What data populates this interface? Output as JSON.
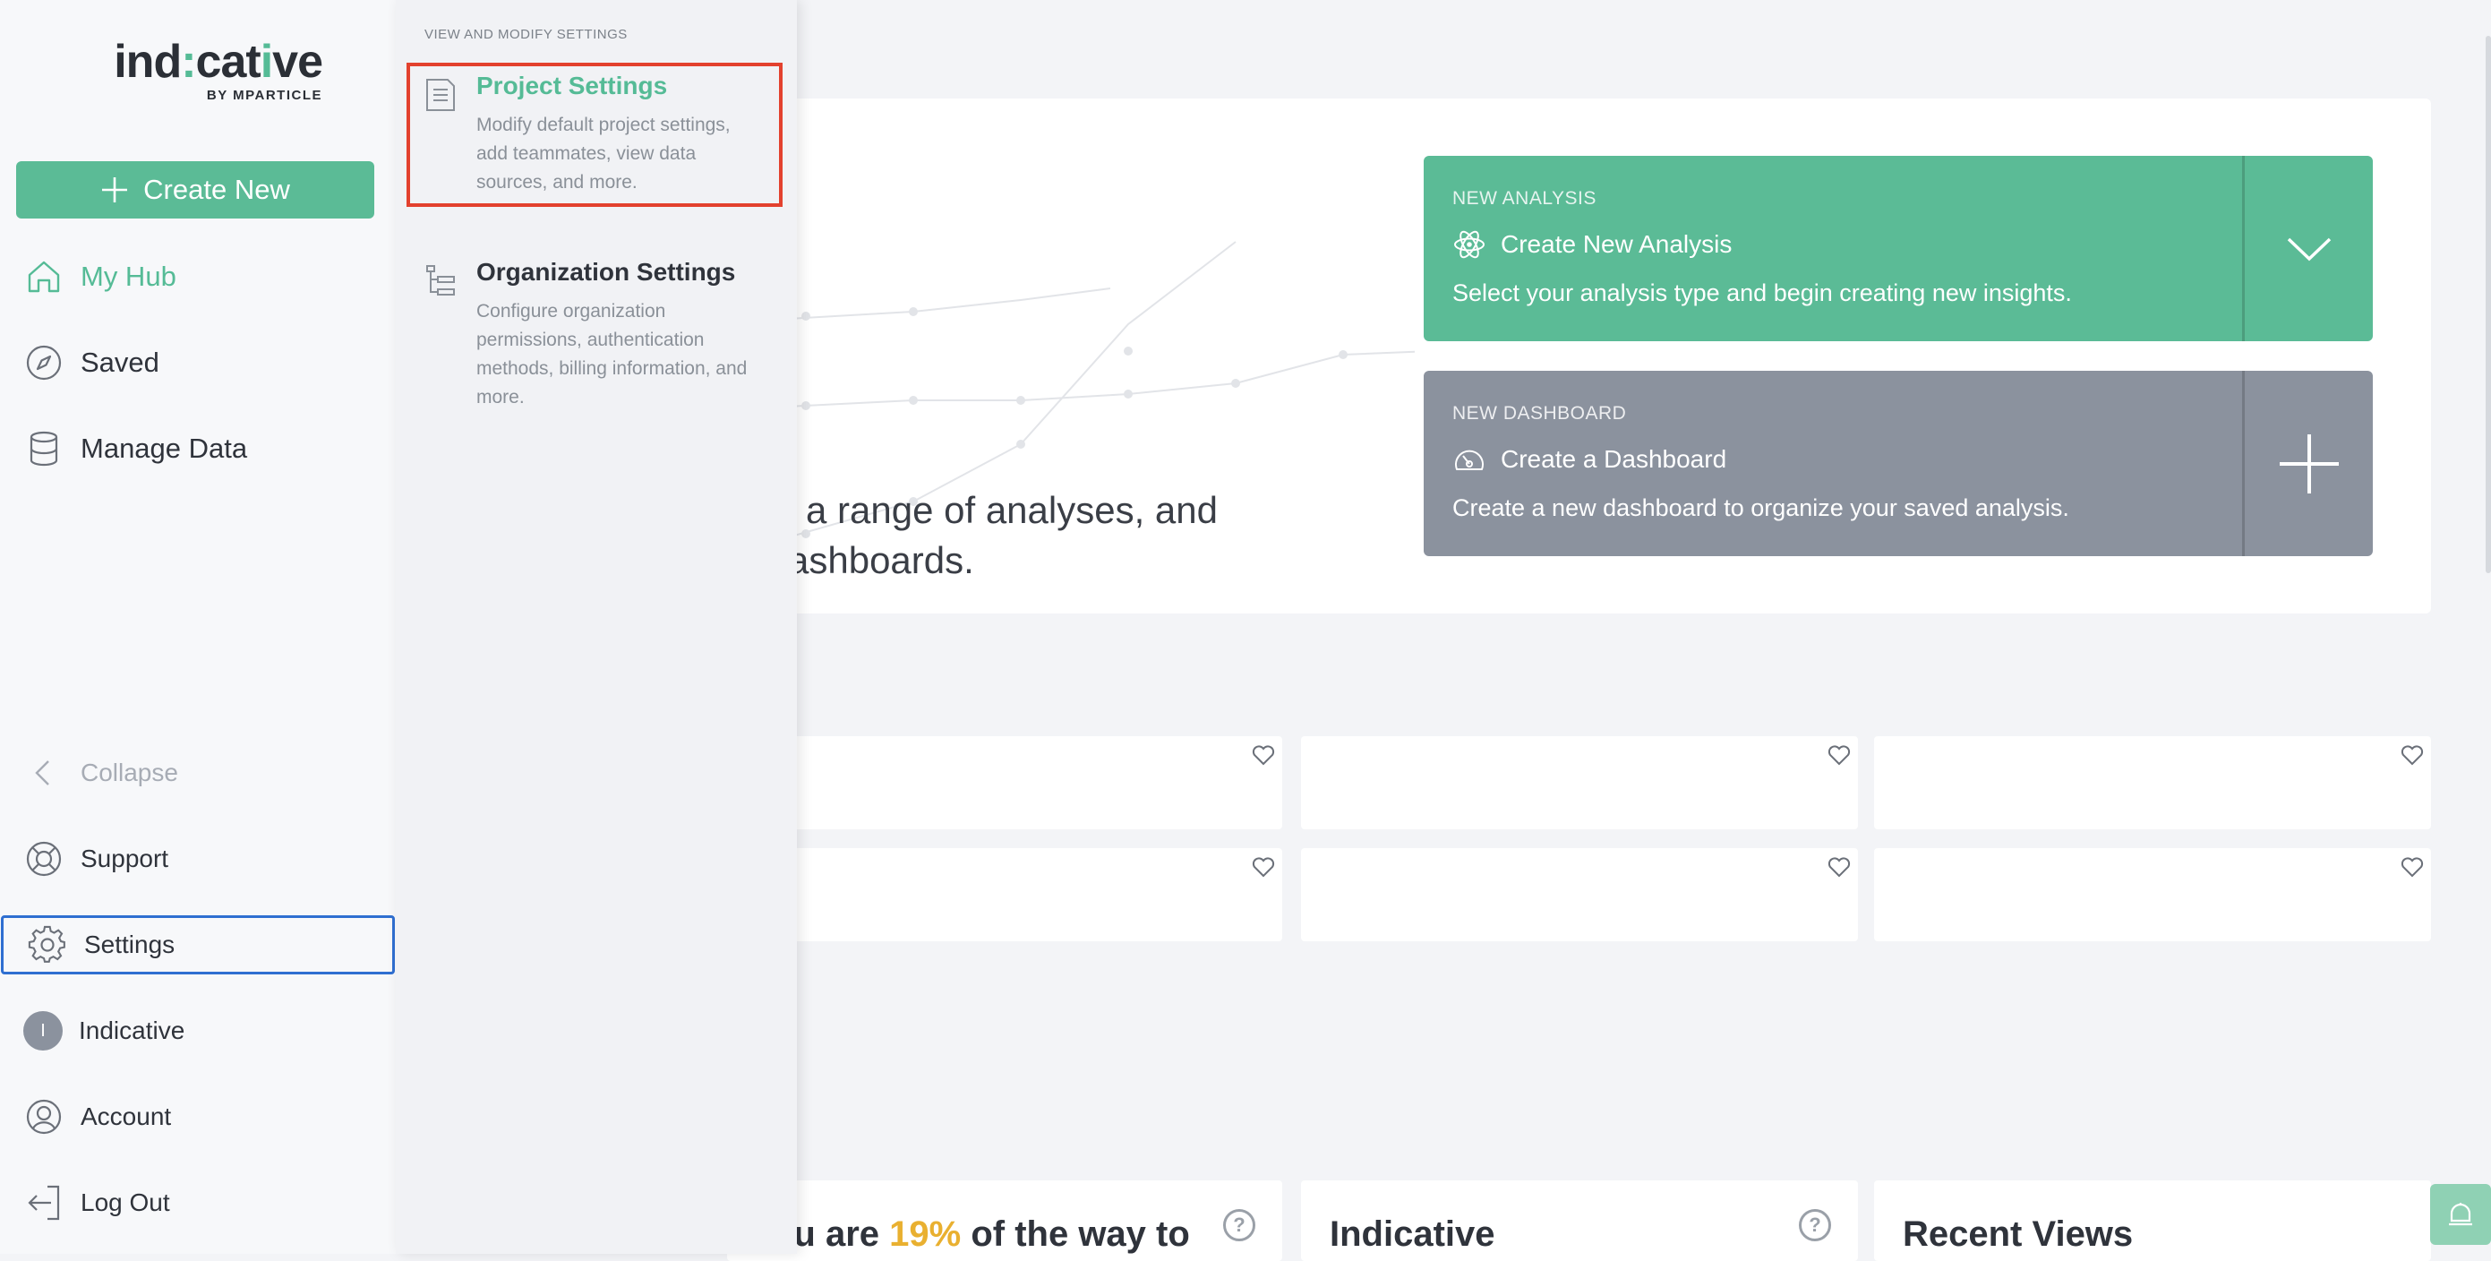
{
  "logo": {
    "main_pre": "ind",
    "main_hl": ":",
    "main_post": "cat",
    "main_hl2": "i",
    "main_end": "ve",
    "sub": "BY MPARTICLE"
  },
  "sidebar": {
    "create_label": "Create New",
    "items": [
      {
        "label": "My Hub",
        "icon": "home-icon"
      },
      {
        "label": "Saved",
        "icon": "compass-icon"
      },
      {
        "label": "Manage Data",
        "icon": "database-icon"
      }
    ],
    "bottom": [
      {
        "label": "Collapse",
        "icon": "chevron-left-icon"
      },
      {
        "label": "Support",
        "icon": "lifebuoy-icon"
      },
      {
        "label": "Settings",
        "icon": "gear-icon"
      },
      {
        "label": "Indicative",
        "icon": "avatar",
        "initial": "I"
      },
      {
        "label": "Account",
        "icon": "user-icon"
      },
      {
        "label": "Log Out",
        "icon": "logout-icon"
      }
    ]
  },
  "flyout": {
    "heading": "VIEW AND MODIFY SETTINGS",
    "items": [
      {
        "title": "Project Settings",
        "desc": "Modify default project settings, add teammates, view data sources, and more.",
        "icon": "document-icon"
      },
      {
        "title": "Organization Settings",
        "desc": "Configure organization permissions, authentication methods, billing information, and more.",
        "icon": "org-tree-icon"
      }
    ]
  },
  "hero": {
    "text_line1": "a range of analyses, and",
    "text_line2": "ashboards.",
    "analysis": {
      "label": "NEW ANALYSIS",
      "title": "Create New Analysis",
      "desc": "Select your analysis type and begin creating new insights."
    },
    "dashboard": {
      "label": "NEW DASHBOARD",
      "title": "Create a Dashboard",
      "desc": "Create a new dashboard to organize your saved analysis."
    }
  },
  "bottom_cards": [
    {
      "pre": "ou are ",
      "pct": "19%",
      "post": " of the way to"
    },
    {
      "title": "Indicative"
    },
    {
      "title": "Recent Views"
    }
  ],
  "colors": {
    "accent": "#5bbb96",
    "gray_card": "#8b929e",
    "highlight": "#e3412e",
    "focus": "#2f6fd1",
    "percent": "#e9b030"
  }
}
